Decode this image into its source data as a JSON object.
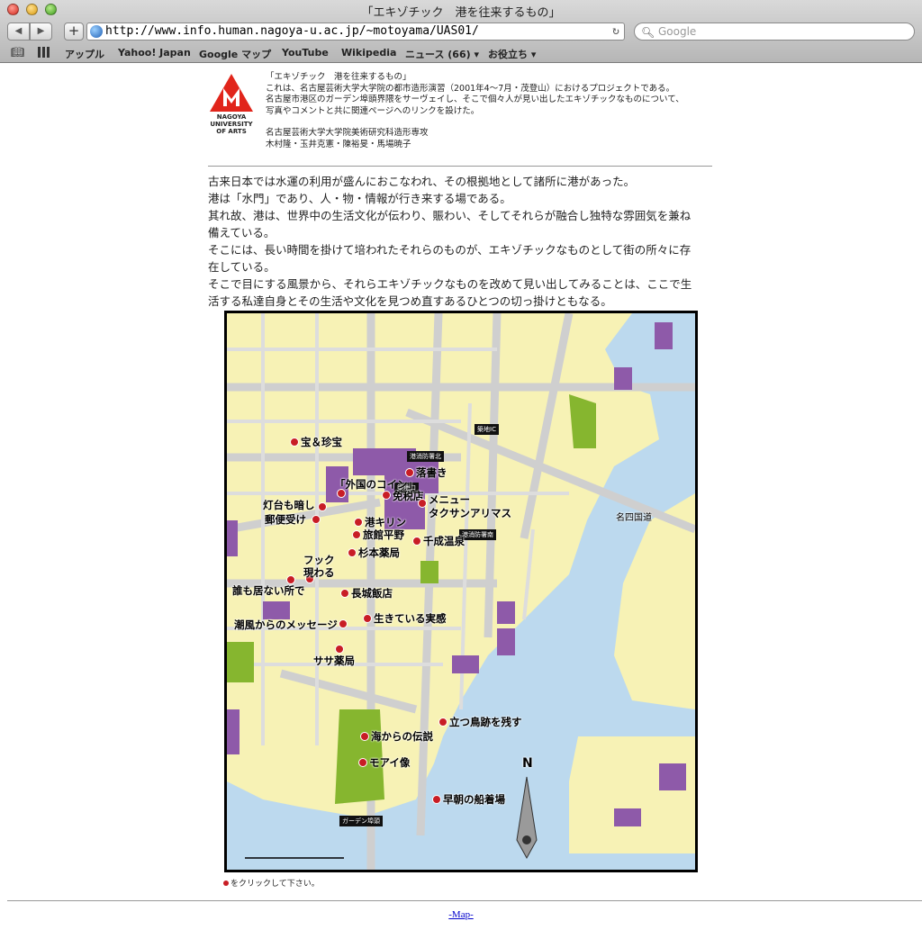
{
  "window": {
    "title": "「エキゾチック　港を往来するもの」"
  },
  "toolbar": {
    "url": "http://www.info.human.nagoya-u.ac.jp/~motoyama/UAS01/",
    "search_placeholder": "Google"
  },
  "bookmarks": [
    "アップル",
    "Yahoo! Japan",
    "Google マップ",
    "YouTube",
    "Wikipedia",
    "ニュース (66) ▾",
    "お役立ち ▾"
  ],
  "logo": {
    "line1": "NAGOYA",
    "line2": "UNIVERSITY",
    "line3": "OF ARTS"
  },
  "intro": {
    "lines": [
      "「エキゾチック　港を往来するもの」",
      "これは、名古屋芸術大学大学院の都市造形演習（2001年4〜7月・茂登山）におけるプロジェクトである。",
      "名古屋市港区のガーデン埠頭界隈をサーヴェイし、そこで個々人が見い出したエキゾチックなものについて、",
      "写真やコメントと共に関連ページへのリンクを設けた。"
    ],
    "credits": [
      "名古屋芸術大学大学院美術研究科造形専攻",
      "木村隆・玉井克憲・陳裕旻・馬場暁子"
    ]
  },
  "body": {
    "lines": [
      "古来日本では水運の利用が盛んにおこなわれ、その根拠地として諸所に港があった。",
      "港は「水門」であり、人・物・情報が行き来する場である。",
      "其れ故、港は、世界中の生活文化が伝わり、賑わい、そしてそれらが融合し独特な雰囲気を兼ね",
      "備えている。",
      "そこには、長い時間を掛けて培われたそれらのものが、エキゾチックなものとして街の所々に存",
      "在している。",
      "そこで目にする風景から、それらエキゾチックなものを改めて見い出してみることは、ここで生",
      "活する私達自身とその生活や文化を見つめ直すあるひとつの切っ掛けともなる。"
    ]
  },
  "map": {
    "labels": [
      "宝＆珍宝",
      "落書き",
      "「外国のコイン」",
      "免税店",
      "メニュー",
      "タクサンアリマス",
      "灯台も暗し",
      "郵便受け",
      "港キリン",
      "旅館平野",
      "千成温泉",
      "杉本薬局",
      "フック",
      "現わる",
      "誰も居ない所で",
      "長城飯店",
      "生きている実感",
      "潮風からのメッセージ",
      "ササ薬局",
      "立つ鳥跡を残す",
      "海からの伝説",
      "モアイ像",
      "早朝の船着場"
    ],
    "tags": [
      "築地IC",
      "港消防署北",
      "築地口",
      "港消防署南",
      "ガーデン埠頭"
    ],
    "road": "名四国道",
    "north": "N"
  },
  "caption": "をクリックして下さい。",
  "footer": {
    "link": "-Map-"
  }
}
